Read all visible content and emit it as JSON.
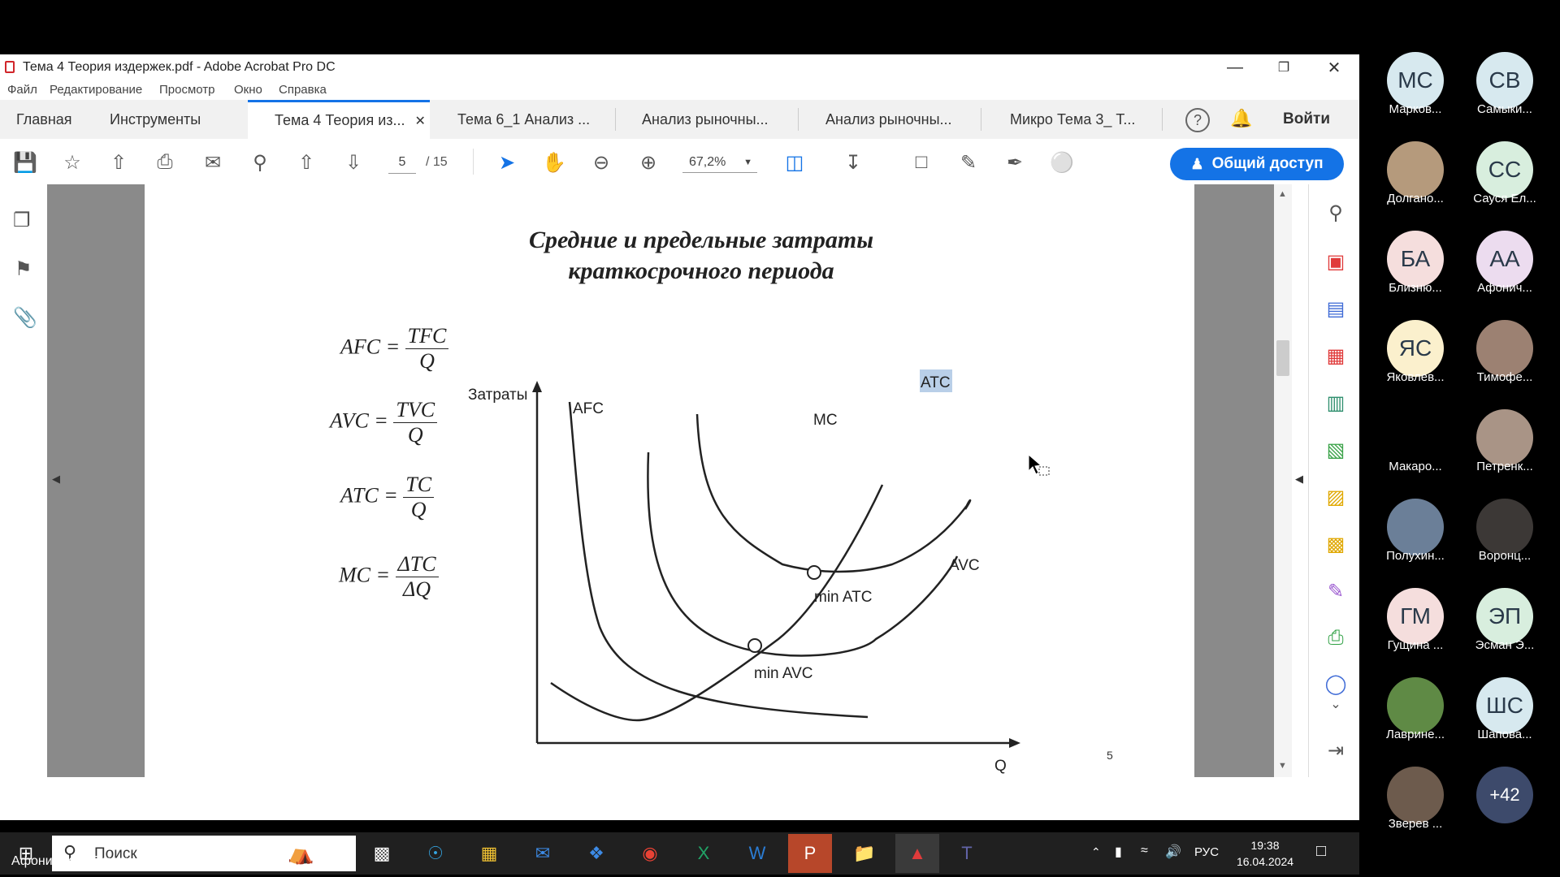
{
  "window": {
    "title": "Тема 4 Теория издержек.pdf - Adobe Acrobat Pro DC",
    "menu": [
      "Файл",
      "Редактирование",
      "Просмотр",
      "Окно",
      "Справка"
    ],
    "nav": {
      "home": "Главная",
      "tools": "Инструменты",
      "signin": "Войти"
    },
    "tabs": [
      {
        "label": "Тема 4 Теория из...",
        "active": true
      },
      {
        "label": "Тема 6_1 Анализ ...",
        "active": false
      },
      {
        "label": "Анализ рыночны...",
        "active": false
      },
      {
        "label": "Анализ рыночны...",
        "active": false
      },
      {
        "label": "Микро Тема 3_ Т...",
        "active": false
      }
    ],
    "toolbar": {
      "page_current": "5",
      "page_total": "/ 15",
      "zoom": "67,2%",
      "share_label": "Общий доступ"
    }
  },
  "document": {
    "title_line1": "Средние и предельные затраты",
    "title_line2": "краткосрочного периода",
    "formulas": [
      {
        "lhs": "AFC =",
        "num": "TFC",
        "den": "Q"
      },
      {
        "lhs": "AVC =",
        "num": "TVC",
        "den": "Q"
      },
      {
        "lhs": "ATC =",
        "num": "TC",
        "den": "Q"
      },
      {
        "lhs": "MC =",
        "num": "ΔTC",
        "den": "ΔQ"
      }
    ],
    "page_number": "5"
  },
  "chart_data": {
    "type": "line",
    "ylabel": "Затраты",
    "xlabel": "Q",
    "series": [
      {
        "name": "AFC"
      },
      {
        "name": "MC"
      },
      {
        "name": "ATC"
      },
      {
        "name": "AVC"
      }
    ],
    "annotations": [
      "min ATC",
      "min AVC"
    ],
    "highlighted_label": "ATC",
    "colors": {
      "curve": "#222222",
      "highlight": "#b9cfe8"
    }
  },
  "taskbar": {
    "search": "Поиск",
    "lang": "РУС",
    "time": "19:38",
    "date": "16.04.2024"
  },
  "participants": [
    {
      "initials": "МС",
      "name": "Марков...",
      "color": "#d7e9ef"
    },
    {
      "initials": "СВ",
      "name": "Самыки...",
      "color": "#d7e9ef"
    },
    {
      "initials": "",
      "name": "Долгано...",
      "color": "#b59a7c"
    },
    {
      "initials": "СС",
      "name": "Сауся Ел...",
      "color": "#d8eede"
    },
    {
      "initials": "БА",
      "name": "Близню...",
      "color": "#f5dedd"
    },
    {
      "initials": "АА",
      "name": "Афонич...",
      "color": "#ecdcef"
    },
    {
      "initials": "ЯС",
      "name": "Яковлев...",
      "color": "#fbf0cd"
    },
    {
      "initials": "",
      "name": "Тимофе...",
      "color": "#9c8172"
    },
    {
      "initials": "",
      "name": "Макаро...",
      "color": "#000000"
    },
    {
      "initials": "",
      "name": "Петренк...",
      "color": "#a99486"
    },
    {
      "initials": "",
      "name": "Полухин...",
      "color": "#6b7f98"
    },
    {
      "initials": "",
      "name": "Воронц...",
      "color": "#3c3836"
    },
    {
      "initials": "ГМ",
      "name": "Гущина ...",
      "color": "#f5dedd"
    },
    {
      "initials": "ЭП",
      "name": "Эсман Э...",
      "color": "#d8eede"
    },
    {
      "initials": "",
      "name": "Лаврине...",
      "color": "#5f8a45"
    },
    {
      "initials": "ШС",
      "name": "Шапова...",
      "color": "#d7e9ef"
    },
    {
      "initials": "",
      "name": "Зверев ...",
      "color": "#6d5b4d"
    },
    {
      "initials": "+42",
      "name": "",
      "color": "#3d4a6b"
    }
  ],
  "presenter": "Афоничкина Екатерина Александровна"
}
